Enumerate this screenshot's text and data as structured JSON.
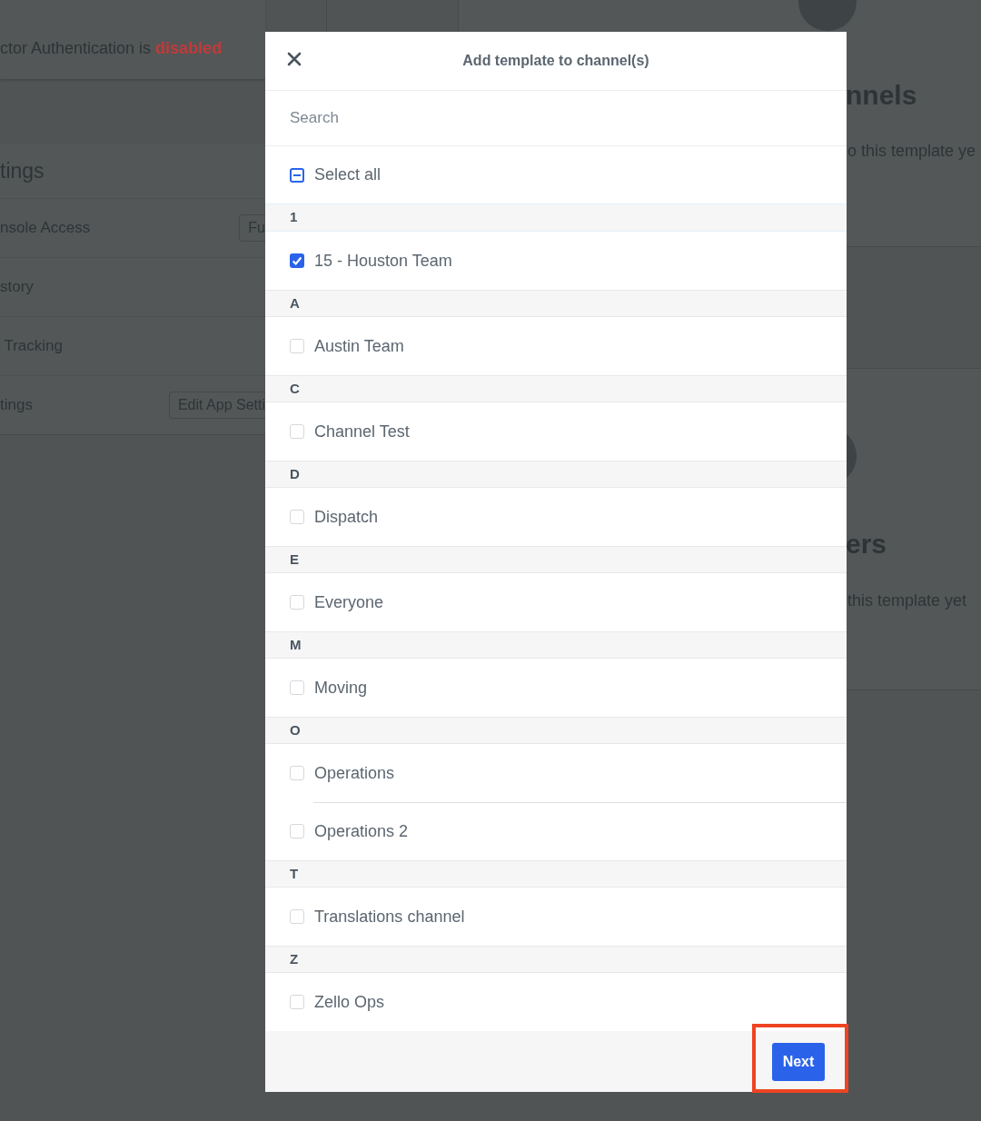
{
  "background": {
    "auth_notice": "ctor Authentication is **disabled**",
    "settings": {
      "heading": "tings",
      "rows": [
        {
          "label": "nsole Access",
          "button": "Fu"
        },
        {
          "label": "story"
        },
        {
          "label": " Tracking"
        },
        {
          "label": "tings",
          "button": "Edit App Setti"
        }
      ]
    },
    "panels": [
      {
        "heading": "nnels",
        "text": "o this template ye"
      },
      {
        "heading": "ers",
        "text": "this template yet"
      }
    ]
  },
  "modal": {
    "title": "Add template to channel(s)",
    "search": {
      "placeholder": "Search"
    },
    "select_all": {
      "label": "Select all",
      "indeterminate": true
    },
    "groups": [
      {
        "letter": "1",
        "channels": [
          {
            "name": "15 - Houston Team",
            "checked": true
          }
        ]
      },
      {
        "letter": "A",
        "channels": [
          {
            "name": "Austin Team",
            "checked": false
          }
        ]
      },
      {
        "letter": "C",
        "channels": [
          {
            "name": "Channel Test",
            "checked": false
          }
        ]
      },
      {
        "letter": "D",
        "channels": [
          {
            "name": "Dispatch",
            "checked": false
          }
        ]
      },
      {
        "letter": "E",
        "channels": [
          {
            "name": "Everyone",
            "checked": false
          }
        ]
      },
      {
        "letter": "M",
        "channels": [
          {
            "name": "Moving",
            "checked": false
          }
        ]
      },
      {
        "letter": "O",
        "channels": [
          {
            "name": "Operations",
            "checked": false
          },
          {
            "name": "Operations 2",
            "checked": false
          }
        ]
      },
      {
        "letter": "T",
        "channels": [
          {
            "name": "Translations channel",
            "checked": false
          }
        ]
      },
      {
        "letter": "Z",
        "channels": [
          {
            "name": "Zello Ops",
            "checked": false
          }
        ]
      }
    ],
    "next_button": {
      "label": "Next",
      "highlighted": true
    }
  }
}
